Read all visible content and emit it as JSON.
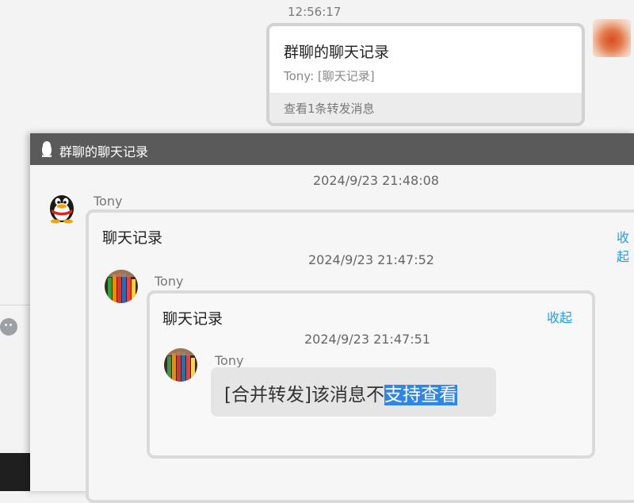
{
  "background_chat": {
    "timestamp": "12:56:17",
    "card": {
      "title": "群聊的聊天记录",
      "preview": "Tony: [聊天记录]",
      "footer": "查看1条转发消息"
    }
  },
  "viewer": {
    "title": "群聊的聊天记录",
    "timestamp": "2024/9/23 21:48:08",
    "sender": "Tony",
    "record": {
      "title": "聊天记录",
      "collapse_label": "收起",
      "timestamp": "2024/9/23 21:47:52",
      "sender": "Tony",
      "nested_record": {
        "title": "聊天记录",
        "collapse_label": "收起",
        "timestamp": "2024/9/23 21:47:51",
        "sender": "Tony",
        "message_plain": "[合并转发]该消息不",
        "message_selected": "支持查看"
      }
    }
  },
  "colors": {
    "titlebar": "#5a5a5a",
    "link": "#1ea0e8",
    "selection": "#2f86e9"
  },
  "icons": [
    "qq-penguin-icon",
    "emoji-icon",
    "pencil-avatar",
    "penguin-avatar"
  ]
}
